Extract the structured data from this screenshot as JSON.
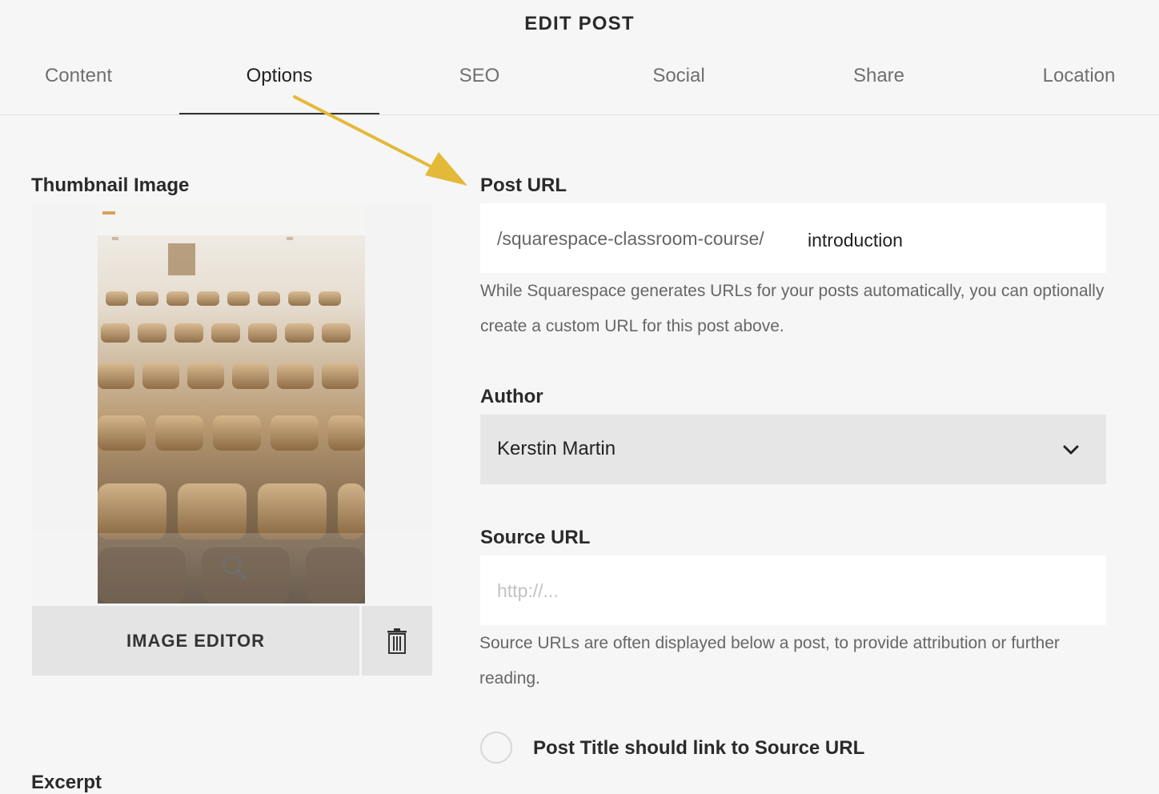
{
  "header": {
    "title": "EDIT POST"
  },
  "tabs": [
    {
      "label": "Content",
      "active": false
    },
    {
      "label": "Options",
      "active": true
    },
    {
      "label": "SEO",
      "active": false
    },
    {
      "label": "Social",
      "active": false
    },
    {
      "label": "Share",
      "active": false
    },
    {
      "label": "Location",
      "active": false
    }
  ],
  "thumbnail": {
    "label": "Thumbnail Image",
    "image_editor_label": "IMAGE EDITOR",
    "zoom_icon": "magnifier-icon",
    "delete_icon": "trash-icon"
  },
  "post_url": {
    "label": "Post URL",
    "prefix": "/squarespace-classroom-course/",
    "slug": "introduction",
    "helper": "While Squarespace generates URLs for your posts automatically, you can optionally create a custom URL for this post above."
  },
  "author": {
    "label": "Author",
    "selected": "Kerstin Martin",
    "dropdown_icon": "chevron-down-icon"
  },
  "source_url": {
    "label": "Source URL",
    "value": "",
    "placeholder": "http://...",
    "helper": "Source URLs are often displayed below a post, to provide attribution or further reading."
  },
  "link_toggle": {
    "label": "Post Title should link to Source URL",
    "checked": false
  },
  "excerpt": {
    "label": "Excerpt"
  },
  "colors": {
    "background": "#f6f6f6",
    "annotation_arrow": "#e3b93a",
    "select_bg": "#e6e6e6",
    "button_bg": "#e4e4e4"
  }
}
